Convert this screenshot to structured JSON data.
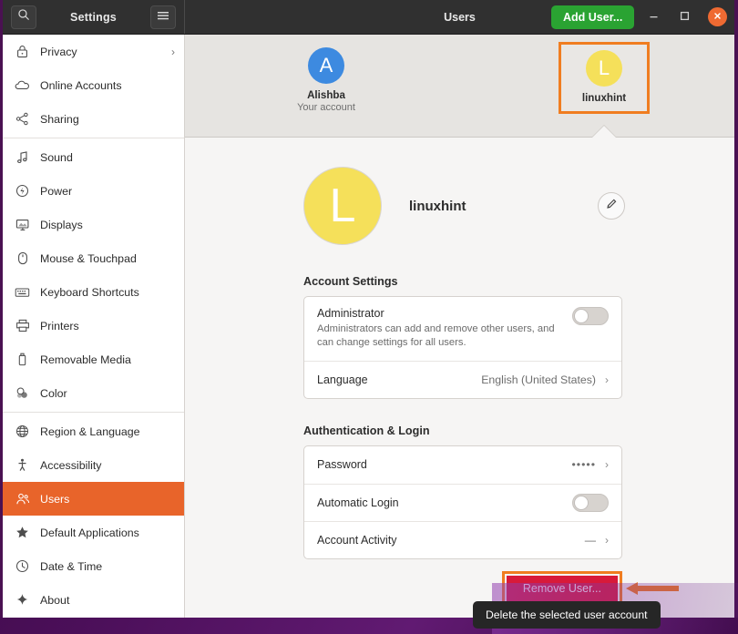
{
  "titlebar": {
    "search_icon": "search-icon",
    "app_title": "Settings",
    "menu_icon": "hamburger-menu-icon",
    "page_title": "Users",
    "add_user_label": "Add User...",
    "minimize_icon": "minimize-icon",
    "maximize_icon": "maximize-icon",
    "close_icon": "close-icon"
  },
  "sidebar": {
    "items": [
      {
        "label": "Privacy",
        "icon": "lock-icon",
        "chevron": "›",
        "active": false
      },
      {
        "label": "Online Accounts",
        "icon": "cloud-icon",
        "chevron": "",
        "active": false
      },
      {
        "label": "Sharing",
        "icon": "share-nodes-icon",
        "chevron": "",
        "active": false
      },
      {
        "label": "Sound",
        "icon": "music-note-icon",
        "chevron": "",
        "active": false
      },
      {
        "label": "Power",
        "icon": "power-icon",
        "chevron": "",
        "active": false
      },
      {
        "label": "Displays",
        "icon": "monitor-icon",
        "chevron": "",
        "active": false
      },
      {
        "label": "Mouse & Touchpad",
        "icon": "mouse-icon",
        "chevron": "",
        "active": false
      },
      {
        "label": "Keyboard Shortcuts",
        "icon": "keyboard-icon",
        "chevron": "",
        "active": false
      },
      {
        "label": "Printers",
        "icon": "printer-icon",
        "chevron": "",
        "active": false
      },
      {
        "label": "Removable Media",
        "icon": "usb-drive-icon",
        "chevron": "",
        "active": false
      },
      {
        "label": "Color",
        "icon": "color-palette-icon",
        "chevron": "",
        "active": false
      },
      {
        "label": "Region & Language",
        "icon": "globe-icon",
        "chevron": "",
        "active": false
      },
      {
        "label": "Accessibility",
        "icon": "accessibility-person-icon",
        "chevron": "",
        "active": false
      },
      {
        "label": "Users",
        "icon": "users-icon",
        "chevron": "",
        "active": true
      },
      {
        "label": "Default Applications",
        "icon": "star-icon",
        "chevron": "",
        "active": false
      },
      {
        "label": "Date & Time",
        "icon": "clock-icon",
        "chevron": "",
        "active": false
      },
      {
        "label": "About",
        "icon": "sparkle-icon",
        "chevron": "",
        "active": false
      }
    ]
  },
  "user_strip": {
    "users": [
      {
        "initial": "A",
        "name": "Alishba",
        "subtitle": "Your account",
        "avatar_color": "#3d8ae0",
        "selected": false
      },
      {
        "initial": "L",
        "name": "linuxhint",
        "subtitle": "",
        "avatar_color": "#f5e05a",
        "selected": true
      }
    ],
    "highlight_color": "#f07d20"
  },
  "profile": {
    "initial": "L",
    "avatar_color": "#f5e05a",
    "name": "linuxhint",
    "edit_icon": "pencil-edit-icon"
  },
  "account_settings": {
    "title": "Account Settings",
    "administrator": {
      "label": "Administrator",
      "description": "Administrators can add and remove other users, and can change settings for all users.",
      "toggle_state": "off"
    },
    "language": {
      "label": "Language",
      "value": "English (United States)",
      "chevron": "›"
    }
  },
  "authentication_login": {
    "title": "Authentication & Login",
    "password": {
      "label": "Password",
      "value": "•••••",
      "chevron": "›"
    },
    "automatic_login": {
      "label": "Automatic Login",
      "toggle_state": "off"
    },
    "account_activity": {
      "label": "Account Activity",
      "value": "—",
      "chevron": "›"
    }
  },
  "remove_user": {
    "label": "Remove User...",
    "highlight_color": "#f07d20",
    "button_color": "#d81a3a",
    "annotation_arrow": "left-pointing-arrow"
  },
  "tooltip": {
    "text": "Delete the selected user account"
  }
}
